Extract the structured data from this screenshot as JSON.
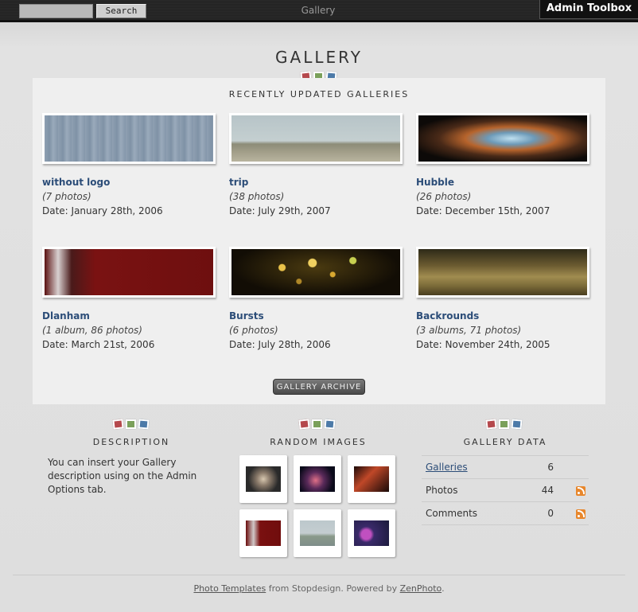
{
  "topbar": {
    "search_placeholder": "",
    "search_button": "Search",
    "title": "Gallery",
    "admin_toolbox": "Admin Toolbox"
  },
  "page_title": "GALLERY",
  "recent": {
    "heading": "RECENTLY UPDATED GALLERIES",
    "albums": [
      {
        "title": "without logo",
        "count": "(7 photos)",
        "date": "Date: January 28th, 2006"
      },
      {
        "title": "trip",
        "count": "(38 photos)",
        "date": "Date: July 29th, 2007"
      },
      {
        "title": "Hubble",
        "count": "(26 photos)",
        "date": "Date: December 15th, 2007"
      },
      {
        "title": "Dlanham",
        "count": "(1 album, 86 photos)",
        "date": "Date: March 21st, 2006"
      },
      {
        "title": "Bursts",
        "count": "(6 photos)",
        "date": "Date: July 28th, 2006"
      },
      {
        "title": "Backrounds",
        "count": "(3 albums, 71 photos)",
        "date": "Date: November 24th, 2005"
      }
    ],
    "archive_button": "GALLERY ARCHIVE"
  },
  "description": {
    "heading": "DESCRIPTION",
    "text": "You can insert your Gallery description using on the Admin Options tab."
  },
  "random": {
    "heading": "RANDOM IMAGES"
  },
  "gallery_data": {
    "heading": "GALLERY DATA",
    "rows": [
      {
        "label": "Galleries",
        "value": "6"
      },
      {
        "label": "Photos",
        "value": "44"
      },
      {
        "label": "Comments",
        "value": "0"
      }
    ]
  },
  "footer": {
    "link1": "Photo Templates",
    "mid": " from Stopdesign. Powered by ",
    "link2": "ZenPhoto",
    "end": "."
  },
  "colors": {
    "link": "#2c4d78",
    "rss": "#e8872c",
    "square_red": "#b5484c",
    "square_green": "#7aa05a",
    "square_blue": "#4c7aa8"
  }
}
